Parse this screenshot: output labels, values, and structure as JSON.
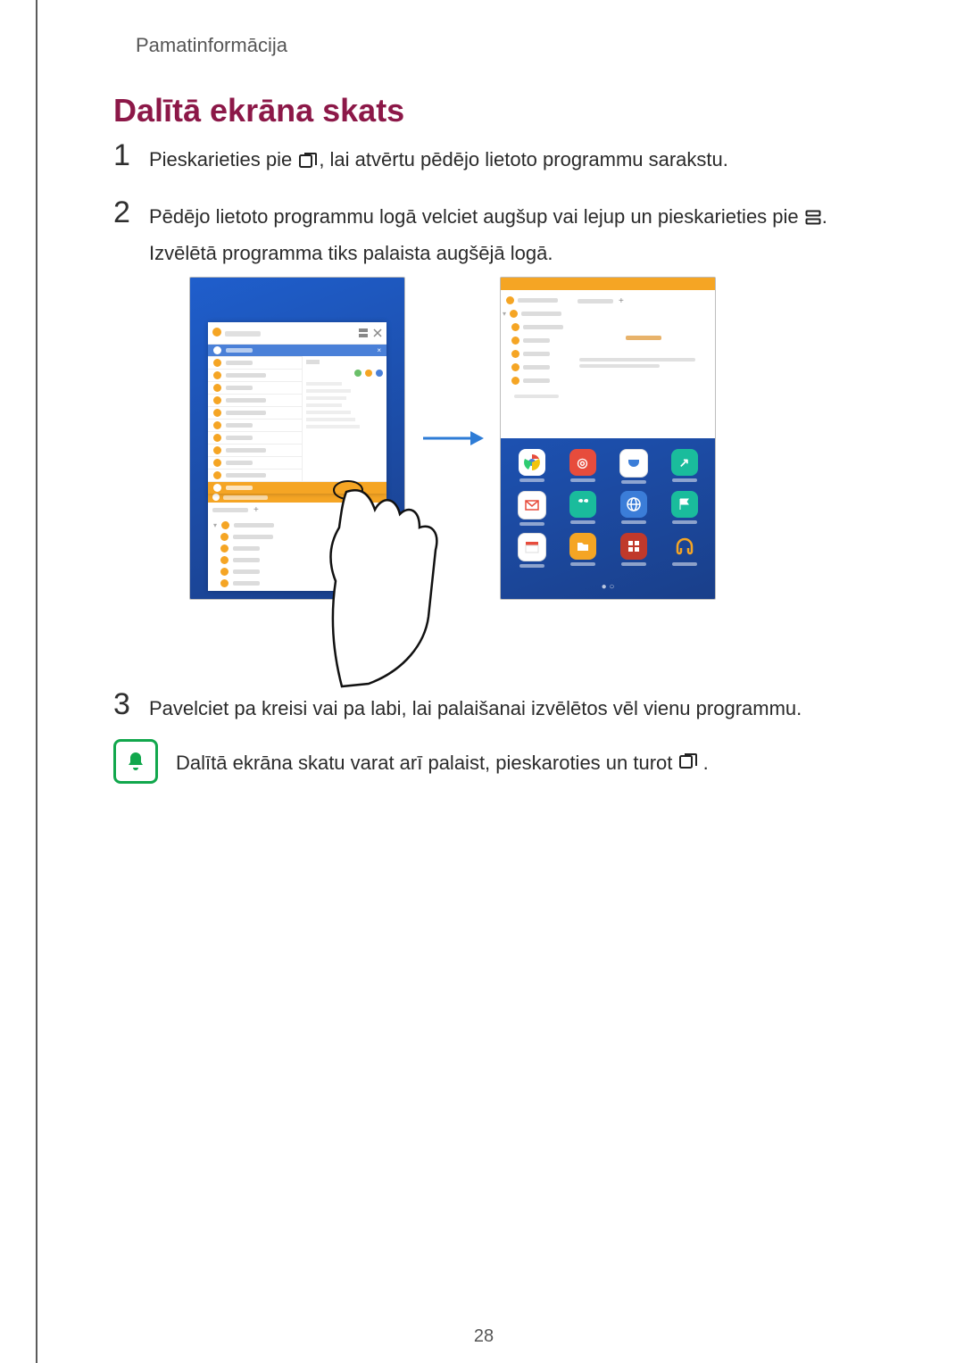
{
  "header": {
    "running_head": "Pamatinformācija"
  },
  "title": "Dalītā ekrāna skats",
  "steps": {
    "one": {
      "num": "1",
      "pre": "Pieskarieties pie ",
      "post": ", lai atvērtu pēdējo lietoto programmu sarakstu."
    },
    "two": {
      "num": "2",
      "line1_pre": "Pēdējo lietoto programmu logā velciet augšup vai lejup un pieskarieties pie ",
      "line1_post": ".",
      "line2": "Izvēlētā programma tiks palaista augšējā logā."
    },
    "three": {
      "num": "3",
      "text": "Pavelciet pa kreisi vai pa labi, lai palaišanai izvēlētos vēl vienu programmu."
    }
  },
  "note": {
    "pre": "Dalītā ekrāna skatu varat arī palaist, pieskaroties un turot ",
    "post": "."
  },
  "icons": {
    "recent": "recent-apps-icon",
    "split": "split-view-icon",
    "bell": "bell-icon"
  },
  "footer": {
    "page_number": "28"
  }
}
